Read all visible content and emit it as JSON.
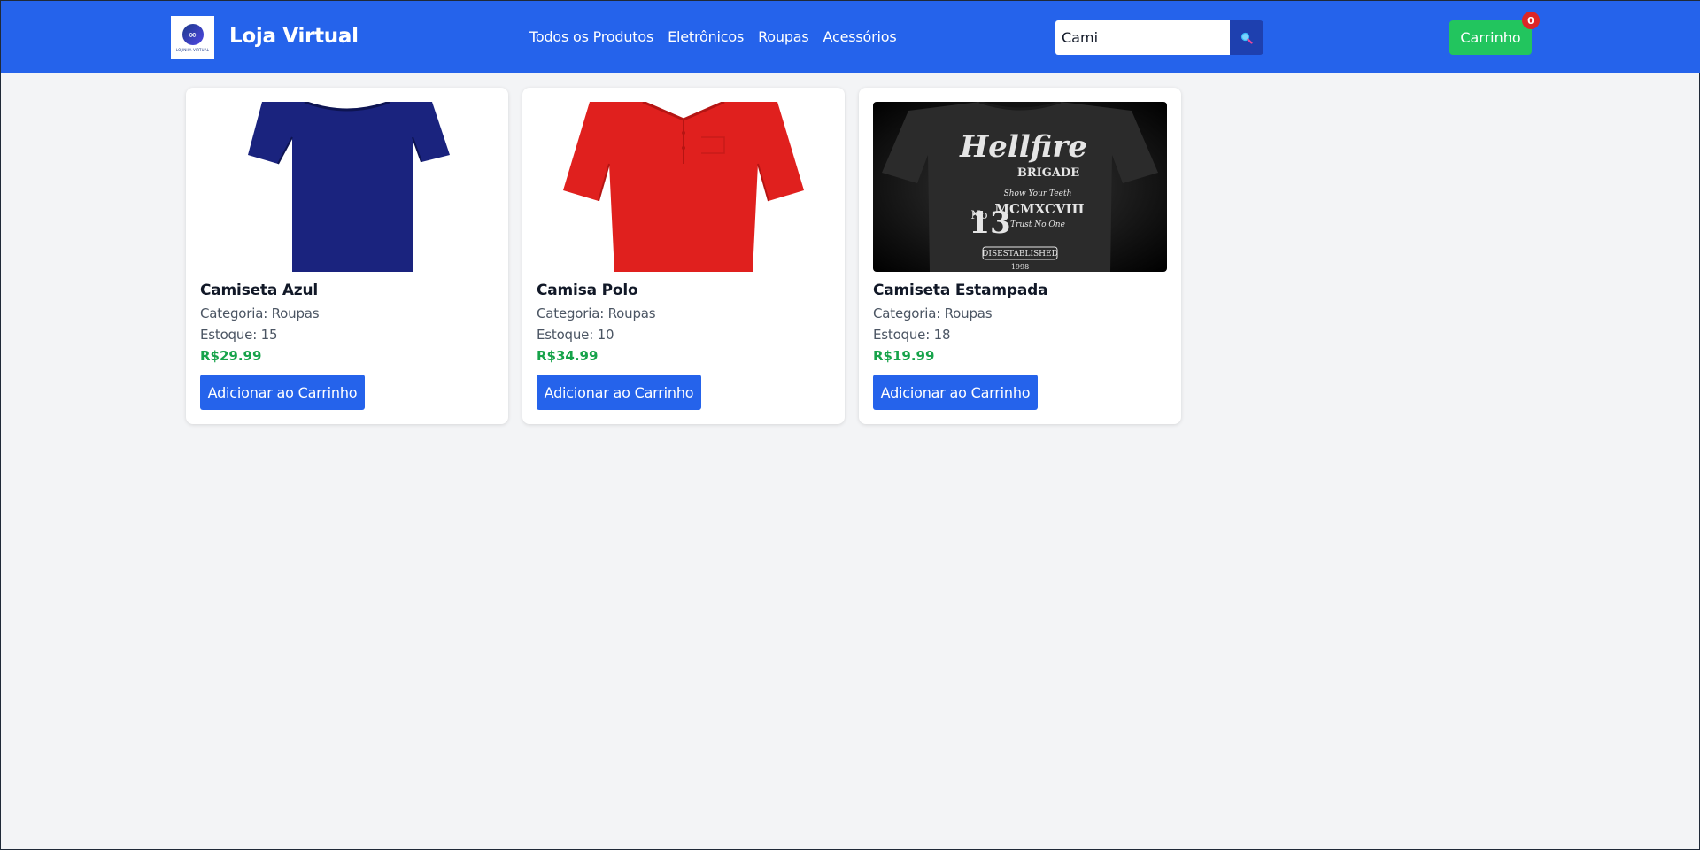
{
  "header": {
    "logo_text": "LOJINHA VIRTUAL",
    "brand": "Loja Virtual",
    "nav": [
      "Todos os Produtos",
      "Eletrônicos",
      "Roupas",
      "Acessórios"
    ],
    "search": {
      "value": "Cami",
      "icon": "search-icon"
    },
    "cart": {
      "label": "Carrinho",
      "count": "0"
    }
  },
  "products": [
    {
      "name": "Camiseta Azul",
      "category": "Categoria: Roupas",
      "stock": "Estoque: 15",
      "price": "R$29.99",
      "button": "Adicionar ao Carrinho",
      "image_color": "#1a237e"
    },
    {
      "name": "Camisa Polo",
      "category": "Categoria: Roupas",
      "stock": "Estoque: 10",
      "price": "R$34.99",
      "button": "Adicionar ao Carrinho",
      "image_color": "#e0201e"
    },
    {
      "name": "Camiseta Estampada",
      "category": "Categoria: Roupas",
      "stock": "Estoque: 18",
      "price": "R$19.99",
      "button": "Adicionar ao Carrinho",
      "image_color": "#2b2b2b",
      "print": {
        "line1": "Hellfire",
        "line2": "BRIGADE",
        "line3": "No",
        "line4": "13",
        "line5": "Show Your Teeth",
        "line6": "MCMXCVIII",
        "line7": "Trust No One",
        "line8": "DISESTABLISHED",
        "line9": "1998"
      }
    }
  ],
  "colors": {
    "header": "#2563eb",
    "accent_green": "#22c55e",
    "price_green": "#16a34a",
    "badge_red": "#dc2626"
  }
}
